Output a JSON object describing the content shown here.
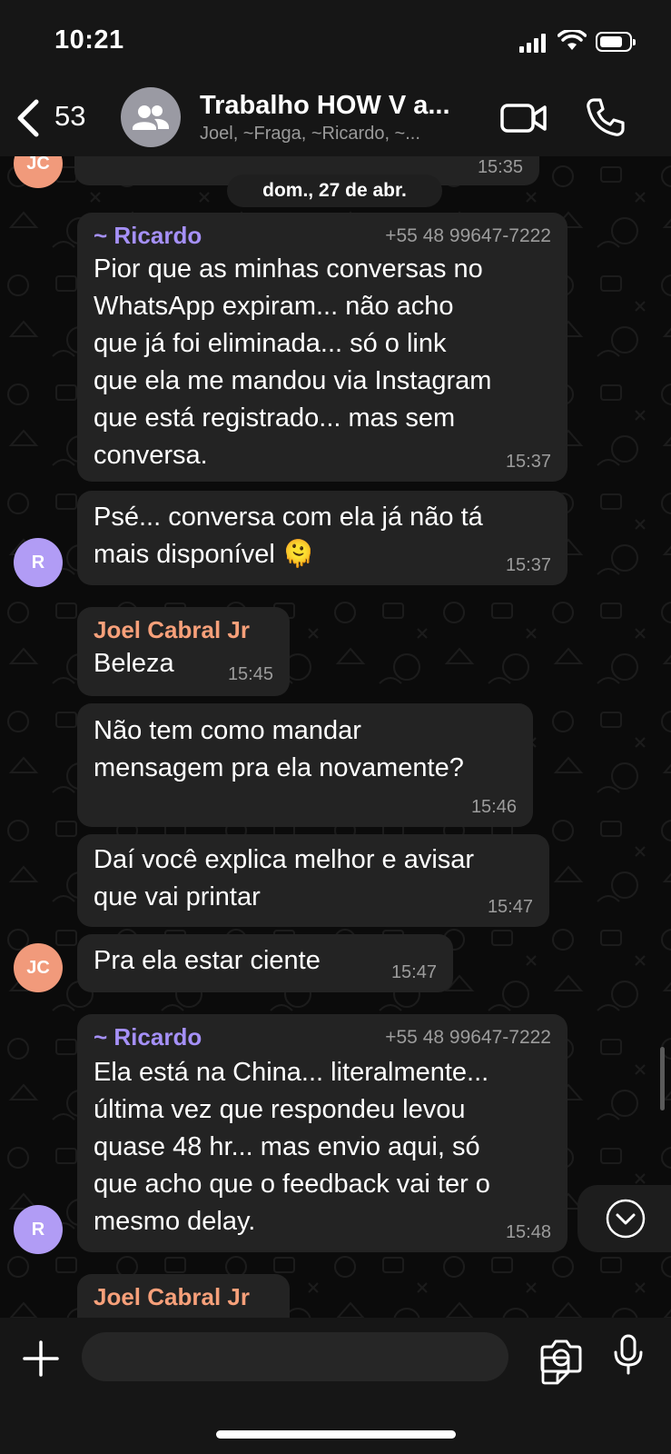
{
  "status": {
    "time": "10:21"
  },
  "header": {
    "back_count": "53",
    "title": "Trabalho HOW V a...",
    "subtitle": "Joel, ~Fraga, ~Ricardo, ~..."
  },
  "colors": {
    "ricardo": "#a590f7",
    "joel": "#f7a07a",
    "avatar_r": "#b19cf5",
    "avatar_jc": "#f19a7b",
    "bubble": "#232323"
  },
  "chat": {
    "top_partial": {
      "avatar": "JC",
      "time": "15:35"
    },
    "date_separator": "dom., 27 de abr.",
    "messages": [
      {
        "sender": "~ Ricardo",
        "phone": "+55 48 99647-7222",
        "lines": [
          "Pior que as minhas conversas no",
          "WhatsApp expiram... não  acho",
          "que já foi eliminada... só o link",
          "que ela me mandou via Instagram",
          "que está registrado... mas sem",
          "conversa."
        ],
        "time": "15:37"
      },
      {
        "lines": [
          "Psé... conversa com ela já não  tá",
          "mais disponível 🫠"
        ],
        "time": "15:37",
        "avatar": "R"
      },
      {
        "sender": "Joel Cabral Jr",
        "lines": [
          "Beleza"
        ],
        "time": "15:45"
      },
      {
        "lines": [
          "Não tem como mandar",
          "mensagem pra ela novamente?"
        ],
        "time": "15:46"
      },
      {
        "lines": [
          "Daí você explica melhor e avisar",
          "que vai printar"
        ],
        "time": "15:47"
      },
      {
        "lines": [
          "Pra ela estar ciente"
        ],
        "time": "15:47",
        "avatar": "JC"
      },
      {
        "sender": "~ Ricardo",
        "phone": "+55 48 99647-7222",
        "lines": [
          "Ela está na China... literalmente...",
          "última vez que respondeu levou",
          "quase 48 hr... mas envio aqui, só",
          "que acho que o feedback vai ter o",
          "mesmo delay."
        ],
        "time": "15:48",
        "avatar": "R"
      }
    ],
    "bottom_partial_sender": "Joel Cabral Jr"
  },
  "composer": {
    "placeholder": ""
  }
}
